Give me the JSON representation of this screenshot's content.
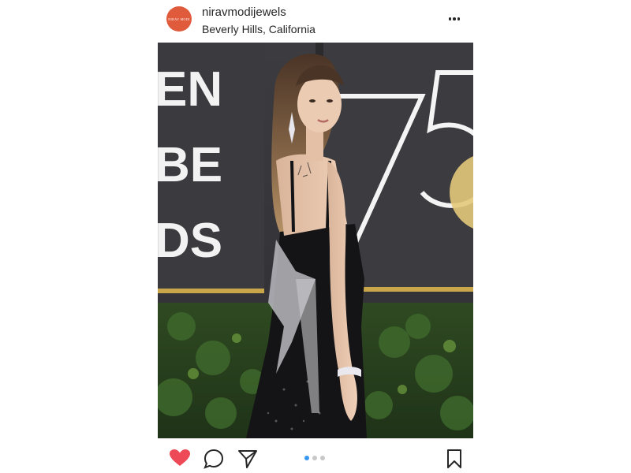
{
  "post": {
    "username": "niravmodijewels",
    "location": "Beverly Hills, California",
    "avatar_text": "NIRAV MODI",
    "backdrop_text": "EN BE DS 75",
    "carousel": {
      "total": 3,
      "active_index": 1
    }
  },
  "icons": {
    "more": "more-options-icon",
    "like": "heart-icon",
    "comment": "comment-icon",
    "share": "share-icon",
    "save": "bookmark-icon"
  },
  "colors": {
    "like_active": "#ed4956",
    "carousel_active": "#3897f0",
    "avatar_bg": "#e05a3c"
  }
}
